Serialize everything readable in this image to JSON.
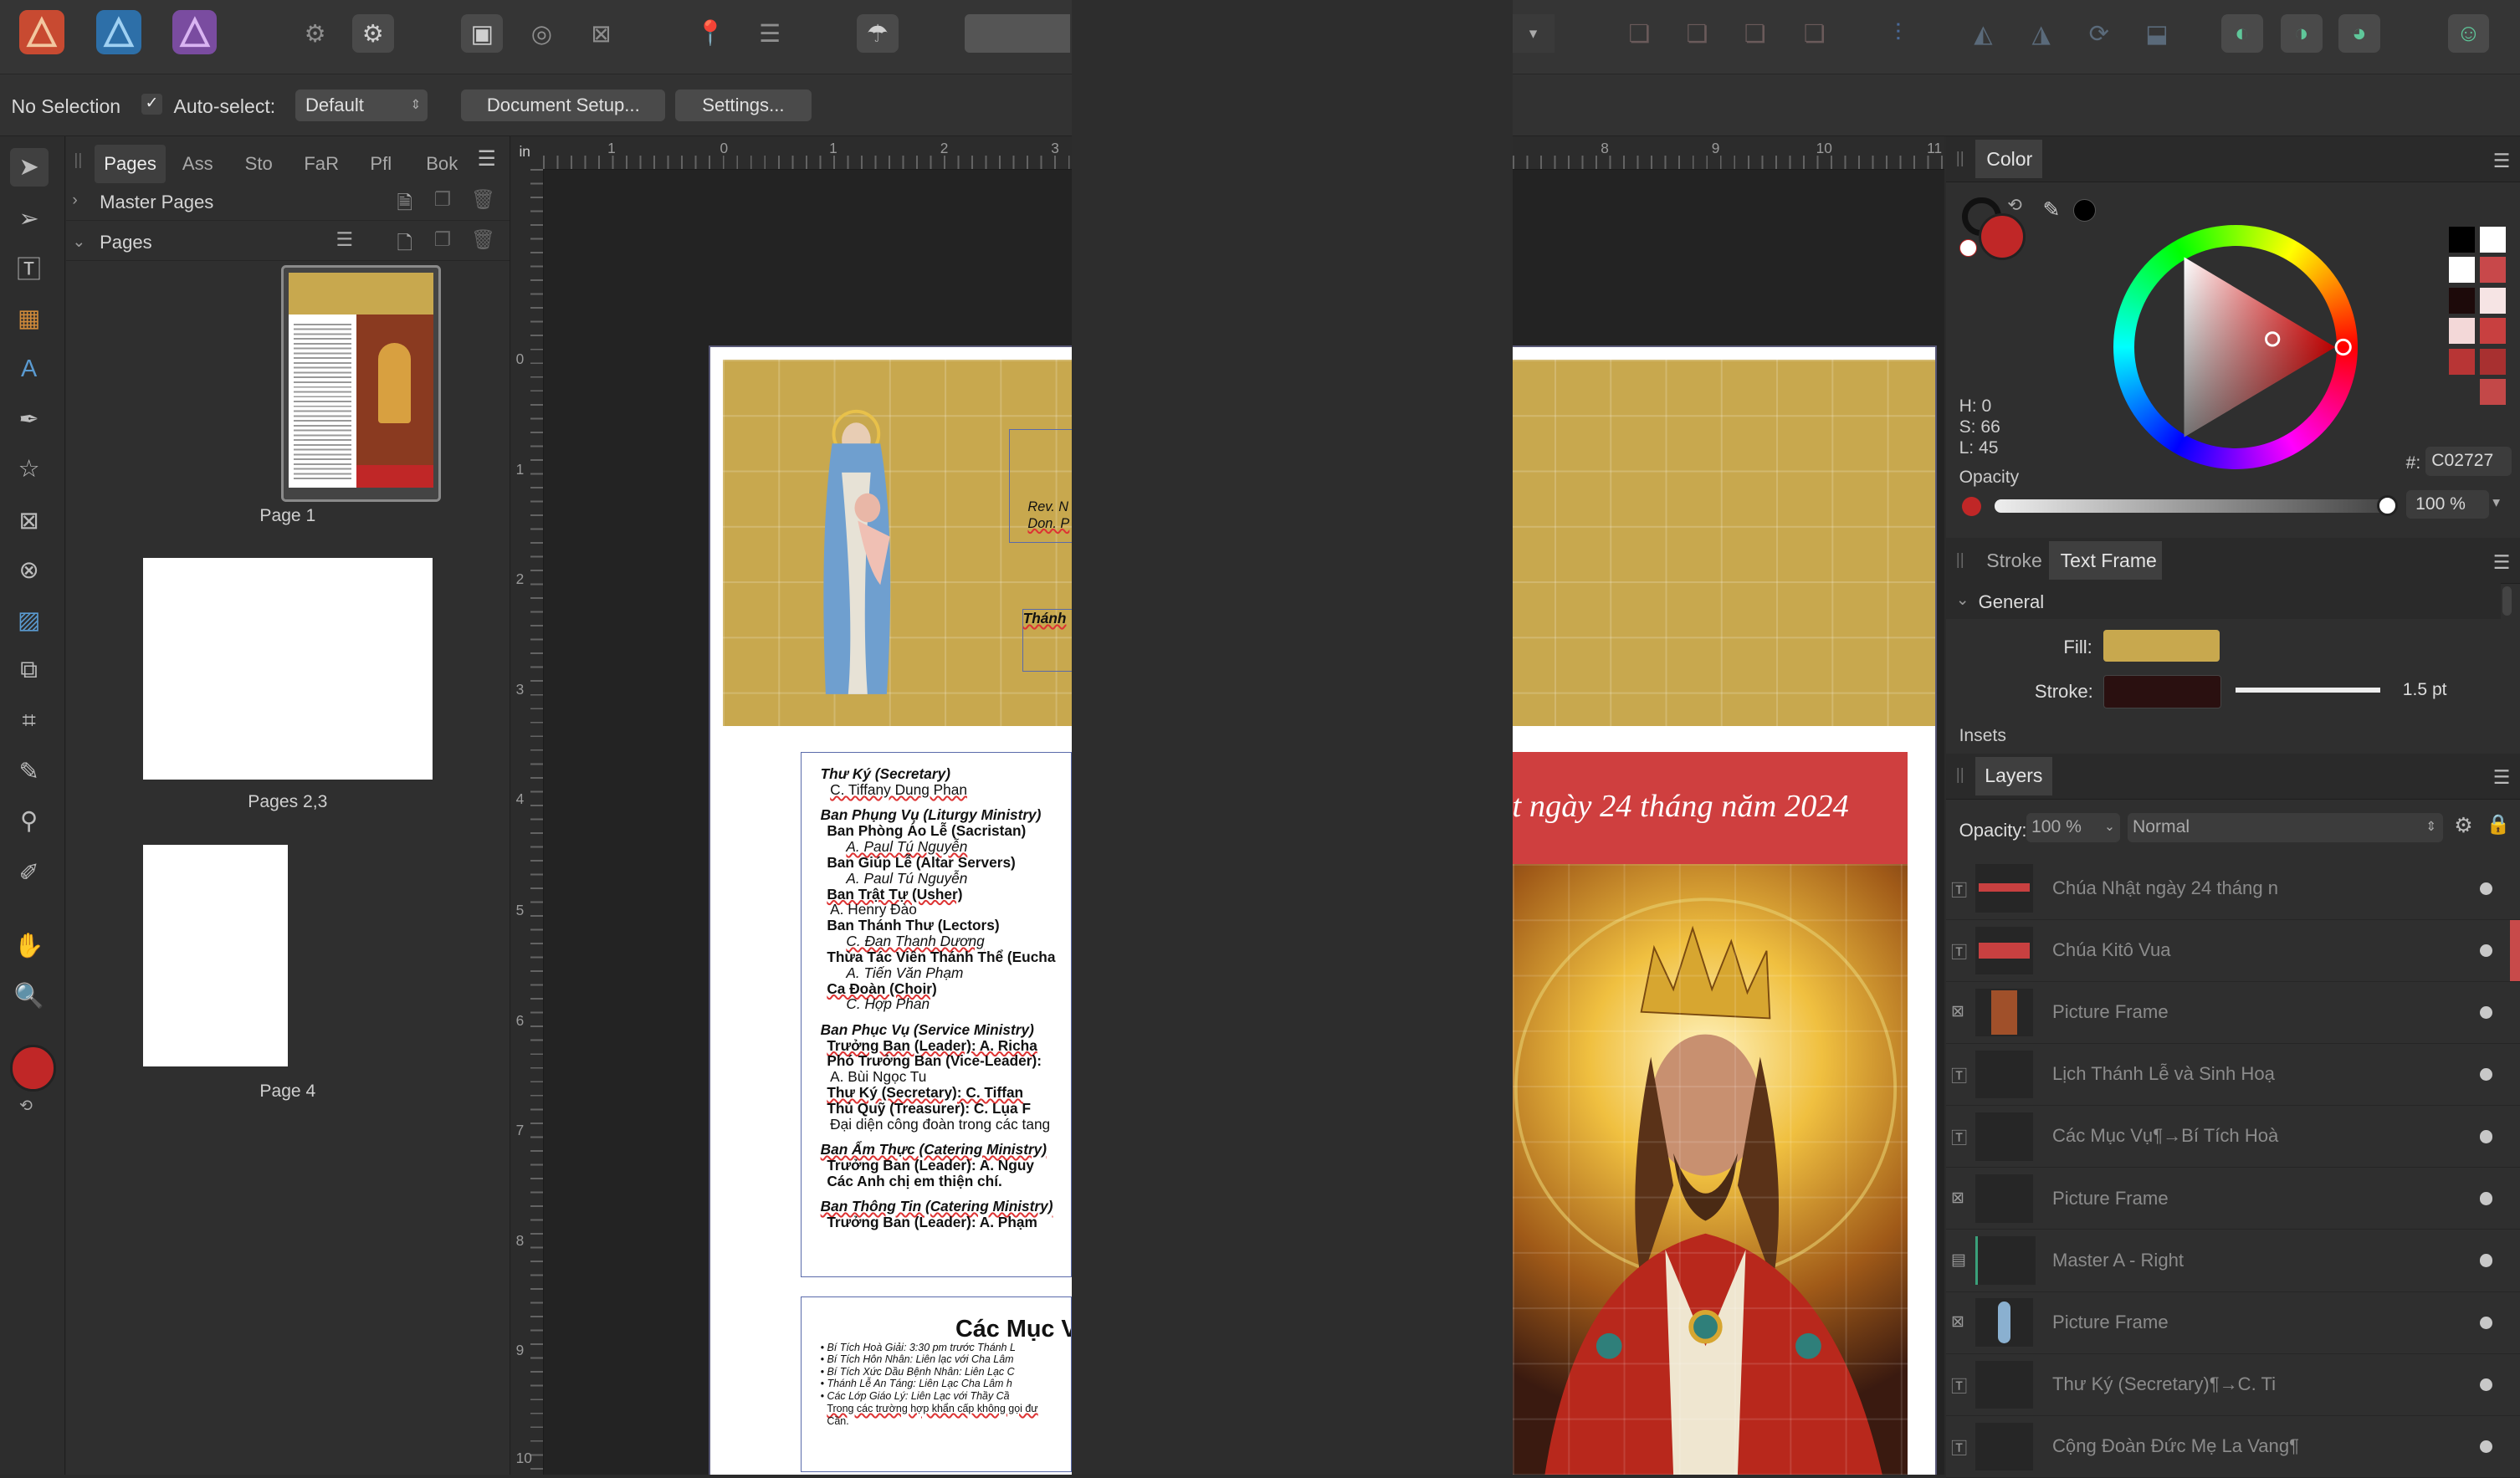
{
  "toolbar": {
    "apps": [
      "publisher",
      "designer",
      "photo"
    ],
    "colors": {
      "publisher": "#c84a31",
      "designer": "#2d6fa8",
      "photo": "#7a4ca0"
    }
  },
  "context": {
    "selection": "No Selection",
    "auto_select_label": "Auto-select:",
    "auto_select_value": "Default",
    "document_setup": "Document Setup...",
    "settings": "Settings..."
  },
  "pages_panel": {
    "tabs": [
      "Pages",
      "Ass",
      "Sto",
      "FaR",
      "Pfl",
      "Bok"
    ],
    "master_pages": "Master Pages",
    "pages": "Pages",
    "thumbs": [
      "Page 1",
      "Pages 2,3",
      "Page 4"
    ]
  },
  "rulers": {
    "unit": "in",
    "top_left": [
      "1",
      "0",
      "1",
      "2",
      "3"
    ],
    "top_right": [
      "8",
      "9",
      "10",
      "11"
    ],
    "left": [
      "0",
      "1",
      "2",
      "3",
      "4",
      "5",
      "6",
      "7",
      "8",
      "9",
      "10"
    ]
  },
  "document": {
    "rev": "Rev. N",
    "don": "Don. P",
    "thanh": "Thánh",
    "staff": [
      {
        "t": "Thư Ký (Secretary)",
        "style": "bi"
      },
      {
        "t": "C. Tiffany Dung Phan",
        "style": "n"
      },
      {
        "t": "Ban Phụng Vụ (Liturgy Ministry)",
        "style": "bi"
      },
      {
        "t": "Ban Phòng Áo Lễ (Sacristan)",
        "style": "b"
      },
      {
        "t": "A. Paul Tú Nguyễn",
        "style": "i"
      },
      {
        "t": "Ban Giúp Lễ (Altar Servers)",
        "style": "b"
      },
      {
        "t": "A. Paul Tú Nguyễn",
        "style": "i"
      },
      {
        "t": "Ban Trật Tự (Usher)",
        "style": "b"
      },
      {
        "t": "A. Henry Đào",
        "style": "n"
      },
      {
        "t": "Ban Thánh Thư (Lectors)",
        "style": "b"
      },
      {
        "t": "C. Đan Thanh Dương",
        "style": "i"
      },
      {
        "t": "Thừa Tác Viên Thánh Thể (Eucha",
        "style": "b"
      },
      {
        "t": "A. Tiến Văn Phạm",
        "style": "i"
      },
      {
        "t": "Ca Đoàn (Choir)",
        "style": "b"
      },
      {
        "t": "C. Hợp Phan",
        "style": "i"
      },
      {
        "t": "Ban Phục Vụ (Service Ministry)",
        "style": "bi"
      },
      {
        "t": "Trưởng Ban (Leader):       A. Richa",
        "style": "b"
      },
      {
        "t": "Phó Trưởng Ban (Vice-Leader):",
        "style": "b"
      },
      {
        "t": "A. Bùi Ngọc Tu",
        "style": "n"
      },
      {
        "t": "Thư Ký (Secretary):         C. Tiffan",
        "style": "b"
      },
      {
        "t": "Thủ Quỹ (Treasurer):        C. Lụa F",
        "style": "b"
      },
      {
        "t": "Đại diện công đoàn trong các tang",
        "style": "n"
      },
      {
        "t": "Ban Ẩm Thực (Catering Ministry)",
        "style": "bi"
      },
      {
        "t": "Trưởng Ban (Leader):       A. Nguy",
        "style": "b"
      },
      {
        "t": "Các Anh chị em thiện chí.",
        "style": "b"
      },
      {
        "t": "Ban Thông Tin (Catering Ministry)",
        "style": "bi"
      },
      {
        "t": "Trưởng Ban (Leader):       A. Phạm",
        "style": "b"
      }
    ],
    "cac_muc": "Các Mục V",
    "bullets": [
      "Bí Tích Hoà Giải: 3:30 pm trước Thánh L",
      "Bí Tích Hôn Nhân: Liên lạc với Cha Lâm",
      "Bí Tích Xức Dầu Bệnh Nhân: Liên Lạc C",
      "Thánh Lễ An Táng: Liên Lạc Cha Lâm h",
      "Các Lớp Giáo Lý: Liên Lạc với Thầy Cầ"
    ],
    "bullet_tail": "Trong các trường hợp khẩn cấp không gọi đư",
    "bullet_tail2": "Cần.",
    "banner": "t ngày 24 tháng năm 2024"
  },
  "color_panel": {
    "title": "Color",
    "h": "H: 0",
    "s": "S: 66",
    "l": "L: 45",
    "opacity_label": "Opacity",
    "hex_label": "#:",
    "hex": "C02727",
    "opacity_value": "100 %",
    "swatches": [
      "#000000",
      "#ffffff",
      "#ffffff",
      "#c8484a",
      "#1d0a0a",
      "#f6e4e4",
      "#f3d8d8",
      "#c84040",
      "#b83535",
      "#a83030",
      "#2f2f2f",
      "#c34848"
    ]
  },
  "stroke_panel": {
    "tabs": [
      "Stroke",
      "Text Frame"
    ],
    "general": "General",
    "fill_label": "Fill:",
    "stroke_label": "Stroke:",
    "stroke_width": "1.5 pt",
    "insets": "Insets",
    "fill_color": "#c8a84e",
    "stroke_color": "#2a1010"
  },
  "layers_panel": {
    "title": "Layers",
    "opacity_label": "Opacity:",
    "opacity_value": "100 %",
    "blend": "Normal",
    "rows": [
      {
        "name": "Chúa Nhật ngày 24 tháng n",
        "icon": "text"
      },
      {
        "name": "Chúa Kitô Vua",
        "icon": "text"
      },
      {
        "name": "Picture Frame",
        "icon": "picture"
      },
      {
        "name": "Lịch Thánh Lễ và Sinh Hoạ",
        "icon": "text"
      },
      {
        "name": "Các Mục Vụ¶→Bí Tích Hoà",
        "icon": "text"
      },
      {
        "name": "Picture Frame",
        "icon": "picture"
      },
      {
        "name": "Master A - Right",
        "icon": "master"
      },
      {
        "name": "Picture Frame",
        "icon": "picture"
      },
      {
        "name": "Thư Ký (Secretary)¶→C. Ti",
        "icon": "text"
      },
      {
        "name": "Cộng Đoàn Đức Mẹ La Vang¶",
        "icon": "text"
      }
    ]
  }
}
